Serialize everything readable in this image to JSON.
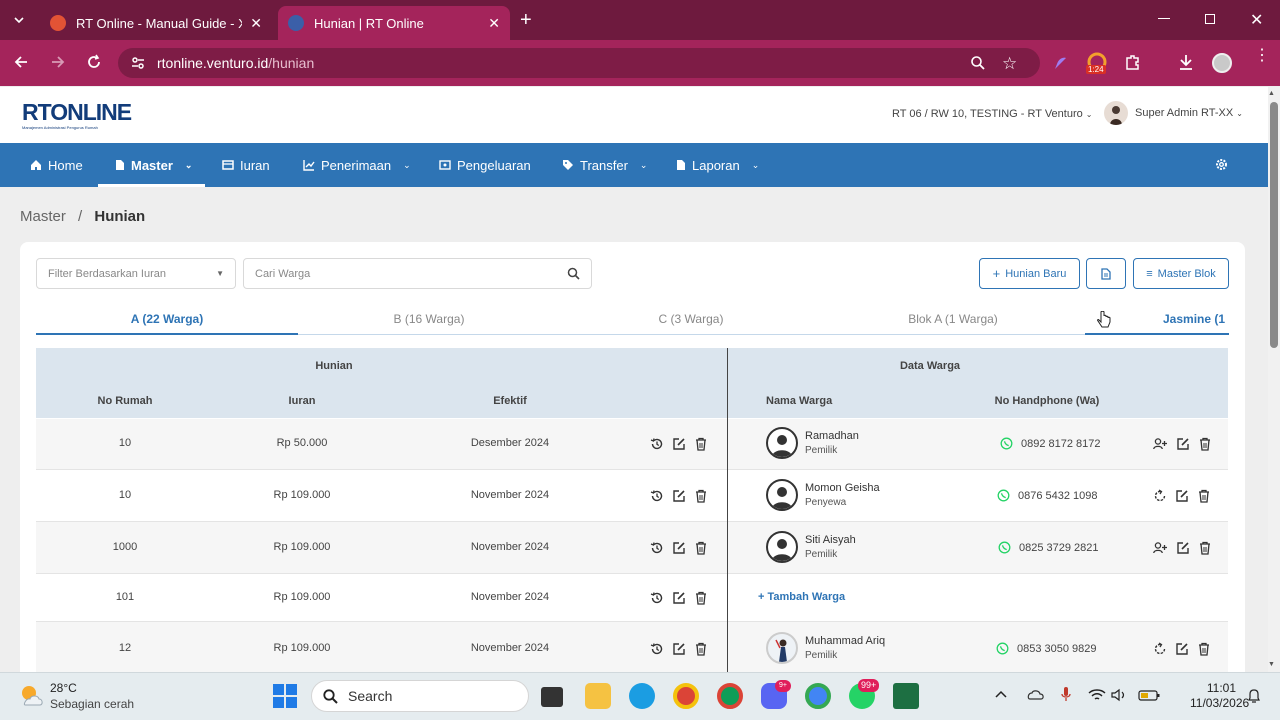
{
  "browser": {
    "tabs": [
      {
        "title": "RT Online - Manual Guide - Xm"
      },
      {
        "title": "Hunian | RT Online"
      }
    ],
    "url_host": "rtonline.venturo.id",
    "url_path": "/hunian",
    "extension_badge": "1:24"
  },
  "site": {
    "logo_text": "RTONLINE",
    "logo_tagline": "Manajemen Administrasi Pengurus Rumah",
    "org": "RT 06 / RW 10, TESTING - RT Venturo",
    "user": "Super Admin RT-XX"
  },
  "nav": [
    {
      "label": "Home"
    },
    {
      "label": "Master"
    },
    {
      "label": "Iuran"
    },
    {
      "label": "Penerimaan"
    },
    {
      "label": "Pengeluaran"
    },
    {
      "label": "Transfer"
    },
    {
      "label": "Laporan"
    }
  ],
  "breadcrumb": {
    "parent": "Master",
    "current": "Hunian"
  },
  "toolbar": {
    "filter_placeholder": "Filter Berdasarkan Iuran",
    "search_placeholder": "Cari Warga",
    "new_label": "Hunian Baru",
    "master_blok_label": "Master Blok"
  },
  "blok_tabs": [
    "A (22 Warga)",
    "B (16 Warga)",
    "C (3 Warga)",
    "Blok A (1 Warga)",
    "Jasmine (1"
  ],
  "table": {
    "group_hunian": "Hunian",
    "group_warga": "Data Warga",
    "col_no_rumah": "No Rumah",
    "col_iuran": "Iuran",
    "col_efektif": "Efektif",
    "col_nama": "Nama Warga",
    "col_phone": "No Handphone (Wa)",
    "add_warga_label": "Tambah Warga",
    "rows": [
      {
        "no": "10",
        "iuran": "Rp 50.000",
        "efektif": "Desember 2024",
        "nama": "Ramadhan",
        "status": "Pemilik",
        "phone": "0892 8172 8172"
      },
      {
        "no": "10",
        "iuran": "Rp 109.000",
        "efektif": "November 2024",
        "nama": "Momon Geisha",
        "status": "Penyewa",
        "phone": "0876 5432 1098"
      },
      {
        "no": "1000",
        "iuran": "Rp 109.000",
        "efektif": "November 2024",
        "nama": "Siti Aisyah",
        "status": "Pemilik",
        "phone": "0825 3729 2821"
      },
      {
        "no": "101",
        "iuran": "Rp 109.000",
        "efektif": "November 2024"
      },
      {
        "no": "12",
        "iuran": "Rp 109.000",
        "efektif": "November 2024",
        "nama": "Muhammad Ariq",
        "status": "Pemilik",
        "phone": "0853 3050 9829"
      }
    ]
  },
  "taskbar": {
    "temp": "28°C",
    "weather": "Sebagian cerah",
    "search": "Search",
    "time": "11:01",
    "date": "11/03/2026",
    "badge": "99+"
  },
  "colors": {
    "primary": "#2e74b5",
    "chrome": "#a4245b",
    "chrome_dark": "#6e1a3e",
    "whatsapp": "#25d366"
  }
}
